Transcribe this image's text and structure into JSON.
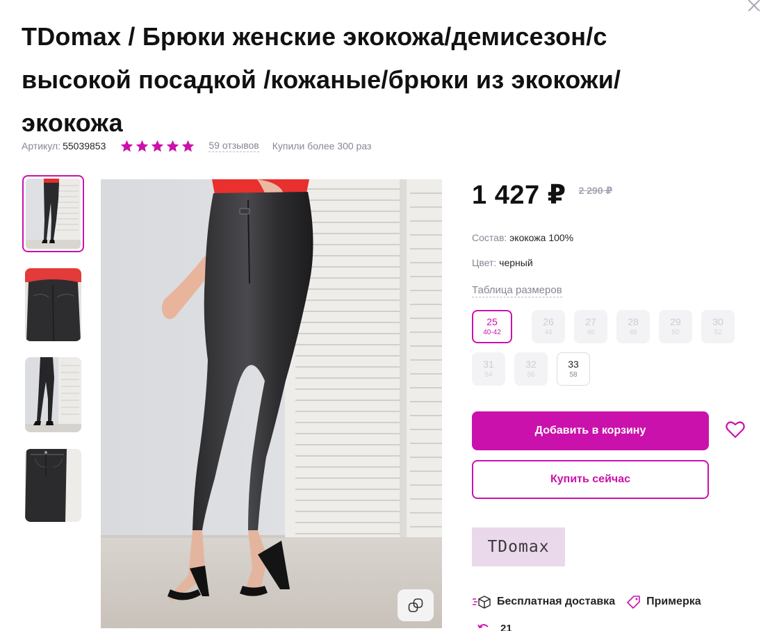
{
  "product": {
    "title": "TDomax / Брюки женские экокожа/демисезон/с высокой посадкой /кожаные/брюки из экокожи/ экокожа",
    "sku_label": "Артикул:",
    "sku_value": "55039853",
    "rating": 5,
    "reviews_label": "59 отзывов",
    "purchased_label": "Купили более 300 раз"
  },
  "pricing": {
    "price": "1 427 ₽",
    "old_price": "2 290 ₽"
  },
  "attributes": {
    "composition_label": "Состав:",
    "composition_value": "экокожа 100%",
    "color_label": "Цвет:",
    "color_value": "черный"
  },
  "size_table_label": "Таблица размеров",
  "sizes": [
    {
      "size": "25",
      "ru": "40-42",
      "state": "selected"
    },
    {
      "size": "26",
      "ru": "44",
      "state": "unavailable"
    },
    {
      "size": "27",
      "ru": "46",
      "state": "unavailable"
    },
    {
      "size": "28",
      "ru": "48",
      "state": "unavailable"
    },
    {
      "size": "29",
      "ru": "50",
      "state": "unavailable"
    },
    {
      "size": "30",
      "ru": "52",
      "state": "unavailable"
    },
    {
      "size": "31",
      "ru": "54",
      "state": "unavailable"
    },
    {
      "size": "32",
      "ru": "56",
      "state": "unavailable"
    },
    {
      "size": "33",
      "ru": "58",
      "state": "available"
    }
  ],
  "actions": {
    "add_to_cart": "Добавить в корзину",
    "buy_now": "Купить сейчас"
  },
  "brand": {
    "logo_text": "TDomax"
  },
  "features": {
    "free_delivery": "Бесплатная доставка",
    "fitting": "Примерка",
    "returns_partial": "21"
  },
  "gallery": {
    "thumbnail_count": 4,
    "active_index": 0
  },
  "colors": {
    "accent": "#cb11ab",
    "muted_text": "#868695",
    "star": "#cb11ab"
  },
  "icons": {
    "close": "close-icon",
    "star": "star-icon",
    "zoom": "similar-icon",
    "favorite": "heart-icon",
    "delivery": "delivery-box-icon",
    "fitting": "tag-icon",
    "returns": "return-icon"
  }
}
